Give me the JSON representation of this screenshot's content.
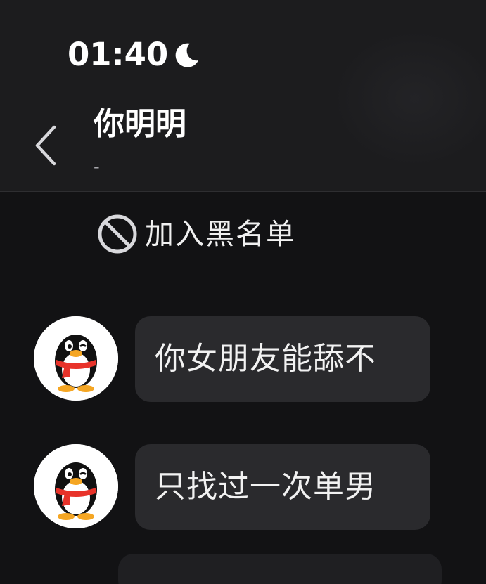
{
  "status_bar": {
    "time": "01:40",
    "icons": [
      "moon-icon"
    ]
  },
  "header": {
    "back_icon": "chevron-left-icon",
    "contact_name": "你明明",
    "contact_status": "-"
  },
  "action_bar": {
    "blacklist_icon": "block-icon",
    "blacklist_label": "加入黑名单"
  },
  "messages": [
    {
      "avatar_icon": "qq-penguin-avatar",
      "text": "你女朋友能舔不"
    },
    {
      "avatar_icon": "qq-penguin-avatar",
      "text": "只找过一次单男"
    }
  ],
  "colors": {
    "background": "#121214",
    "header": "#1c1c1e",
    "bubble": "#2a2a2d",
    "text": "#f2f2f2",
    "penguin_scarf": "#e8332a",
    "penguin_feet": "#f5a623"
  }
}
